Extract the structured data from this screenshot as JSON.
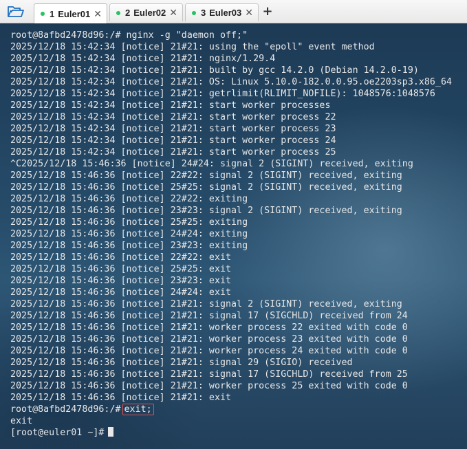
{
  "tabs": [
    {
      "num": "1",
      "label": "Euler01",
      "active": true,
      "dot_color": "#22c55e"
    },
    {
      "num": "2",
      "label": "Euler02",
      "active": false,
      "dot_color": "#22c55e"
    },
    {
      "num": "3",
      "label": "Euler03",
      "active": false,
      "dot_color": "#22c55e"
    }
  ],
  "icons": {
    "folder": "folder-icon",
    "close": "close-icon",
    "add": "plus-icon"
  },
  "terminal": {
    "lines": [
      "root@8afbd2478d96:/# nginx -g \"daemon off;\"",
      "2025/12/18 15:42:34 [notice] 21#21: using the \"epoll\" event method",
      "2025/12/18 15:42:34 [notice] 21#21: nginx/1.29.4",
      "2025/12/18 15:42:34 [notice] 21#21: built by gcc 14.2.0 (Debian 14.2.0-19)",
      "2025/12/18 15:42:34 [notice] 21#21: OS: Linux 5.10.0-182.0.0.95.oe2203sp3.x86_64",
      "2025/12/18 15:42:34 [notice] 21#21: getrlimit(RLIMIT_NOFILE): 1048576:1048576",
      "2025/12/18 15:42:34 [notice] 21#21: start worker processes",
      "2025/12/18 15:42:34 [notice] 21#21: start worker process 22",
      "2025/12/18 15:42:34 [notice] 21#21: start worker process 23",
      "2025/12/18 15:42:34 [notice] 21#21: start worker process 24",
      "2025/12/18 15:42:34 [notice] 21#21: start worker process 25",
      "^C2025/12/18 15:46:36 [notice] 24#24: signal 2 (SIGINT) received, exiting",
      "2025/12/18 15:46:36 [notice] 22#22: signal 2 (SIGINT) received, exiting",
      "2025/12/18 15:46:36 [notice] 25#25: signal 2 (SIGINT) received, exiting",
      "2025/12/18 15:46:36 [notice] 22#22: exiting",
      "2025/12/18 15:46:36 [notice] 23#23: signal 2 (SIGINT) received, exiting",
      "2025/12/18 15:46:36 [notice] 25#25: exiting",
      "2025/12/18 15:46:36 [notice] 24#24: exiting",
      "2025/12/18 15:46:36 [notice] 23#23: exiting",
      "2025/12/18 15:46:36 [notice] 22#22: exit",
      "2025/12/18 15:46:36 [notice] 25#25: exit",
      "2025/12/18 15:46:36 [notice] 23#23: exit",
      "2025/12/18 15:46:36 [notice] 24#24: exit",
      "2025/12/18 15:46:36 [notice] 21#21: signal 2 (SIGINT) received, exiting",
      "2025/12/18 15:46:36 [notice] 21#21: signal 17 (SIGCHLD) received from 24",
      "2025/12/18 15:46:36 [notice] 21#21: worker process 22 exited with code 0",
      "2025/12/18 15:46:36 [notice] 21#21: worker process 23 exited with code 0",
      "2025/12/18 15:46:36 [notice] 21#21: worker process 24 exited with code 0",
      "2025/12/18 15:46:36 [notice] 21#21: signal 29 (SIGIO) received",
      "2025/12/18 15:46:36 [notice] 21#21: signal 17 (SIGCHLD) received from 25",
      "2025/12/18 15:46:36 [notice] 21#21: worker process 25 exited with code 0",
      "2025/12/18 15:46:36 [notice] 21#21: exit"
    ],
    "exit_prompt": "root@8afbd2478d96:/#",
    "exit_command": "exit;",
    "exit_output": "exit",
    "final_prompt": "[root@euler01 ~]#",
    "highlight_color": "#e05050"
  }
}
